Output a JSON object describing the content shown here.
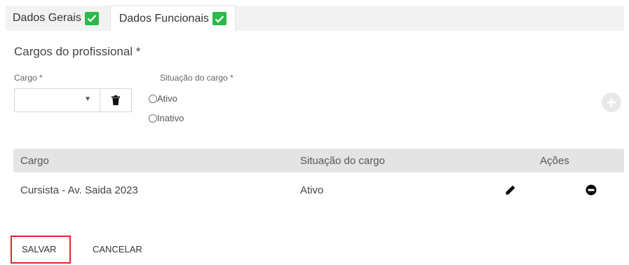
{
  "tabs": [
    {
      "label": "Dados Gerais",
      "completed": true
    },
    {
      "label": "Dados Funcionais",
      "completed": true,
      "active": true
    }
  ],
  "section": {
    "title": "Cargos do profissional *"
  },
  "form": {
    "cargo_label": "Cargo *",
    "cargo_value": "",
    "situacao_label": "Situação do cargo *",
    "options": [
      "Ativo",
      "Inativo"
    ],
    "selected_option": null
  },
  "table": {
    "columns": [
      "Cargo",
      "Situação do cargo",
      "Ações"
    ],
    "rows": [
      {
        "cargo": "Cursista - Av. Saida 2023",
        "situacao": "Ativo"
      }
    ]
  },
  "actions": {
    "save_label": "SALVAR",
    "cancel_label": "CANCELAR"
  },
  "colors": {
    "check_badge": "#2eb84a",
    "highlight_outline": "#e0242e",
    "table_header_bg": "#e4e4e4"
  },
  "icons": [
    "check-icon",
    "caret-down-icon",
    "trash-icon",
    "plus-icon",
    "pencil-icon",
    "minus-circle-icon"
  ]
}
